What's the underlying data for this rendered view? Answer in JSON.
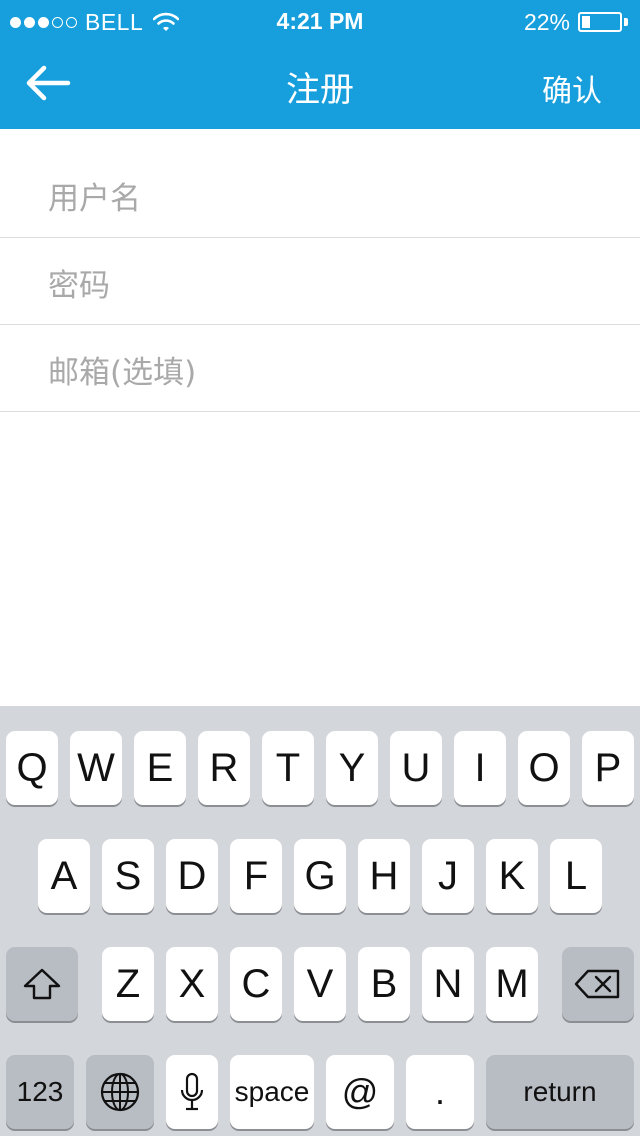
{
  "status_bar": {
    "carrier": "BELL",
    "time": "4:21 PM",
    "battery_percent": "22%",
    "battery_level": 0.22,
    "signal_bars": 3
  },
  "nav": {
    "back_icon": "arrow-left-icon",
    "title": "注册",
    "confirm_label": "确认",
    "background_color": "#169fdc"
  },
  "form": {
    "username_placeholder": "用户名",
    "password_placeholder": "密码",
    "email_placeholder": "邮箱(选填)"
  },
  "keyboard": {
    "row1": [
      "Q",
      "W",
      "E",
      "R",
      "T",
      "Y",
      "U",
      "I",
      "O",
      "P"
    ],
    "row2": [
      "A",
      "S",
      "D",
      "F",
      "G",
      "H",
      "J",
      "K",
      "L"
    ],
    "row3": [
      "Z",
      "X",
      "C",
      "V",
      "B",
      "N",
      "M"
    ],
    "numbers_label": "123",
    "space_label": "space",
    "at_label": "@",
    "period_label": ".",
    "return_label": "return",
    "shift_icon": "shift-icon",
    "delete_icon": "delete-icon",
    "globe_icon": "globe-icon",
    "mic_icon": "microphone-icon"
  }
}
